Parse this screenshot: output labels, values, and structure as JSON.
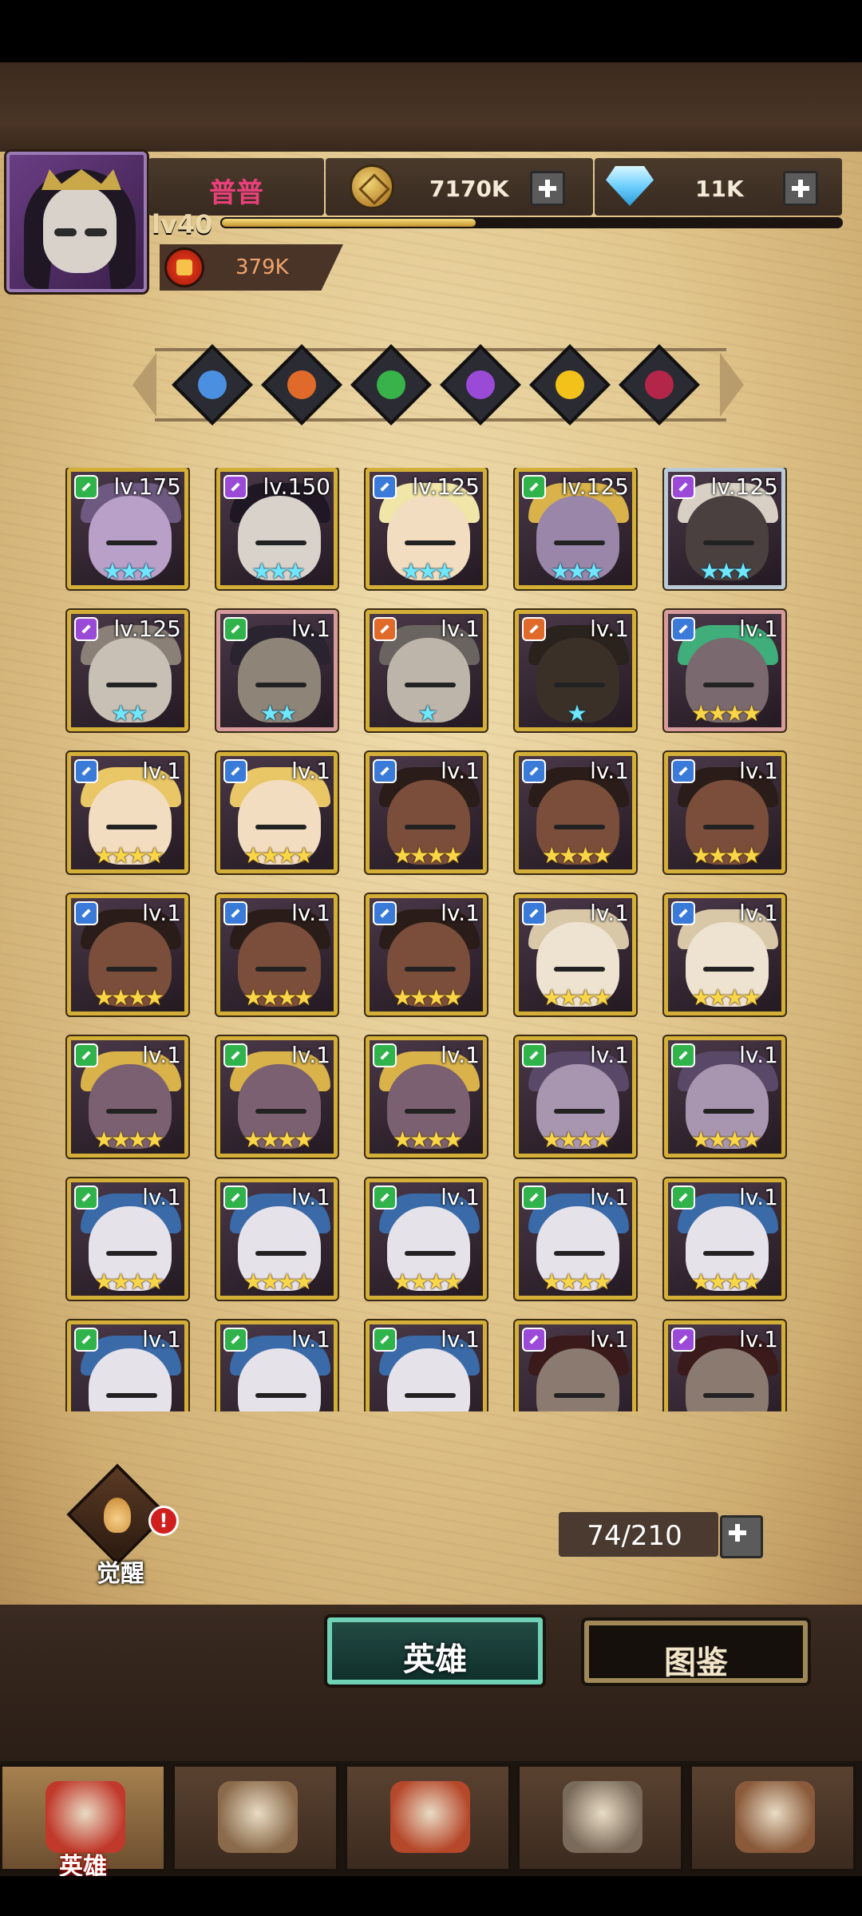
{
  "player": {
    "name": "普普",
    "level": "lv40",
    "xp_fraction": 0.41,
    "power": "379K"
  },
  "resources": {
    "gold": "7170K",
    "gems": "11K"
  },
  "factions": [
    {
      "name": "water-faction-icon",
      "color": "#4a8fe0"
    },
    {
      "name": "fire-faction-icon",
      "color": "#e06a2a"
    },
    {
      "name": "nature-faction-icon",
      "color": "#37b34a"
    },
    {
      "name": "arcane-faction-icon",
      "color": "#9b4ad8"
    },
    {
      "name": "light-faction-icon",
      "color": "#f2c21a"
    },
    {
      "name": "dark-faction-icon",
      "color": "#b4254a"
    }
  ],
  "heroes": [
    {
      "level": "lv.175",
      "stars": 3,
      "star_color": "cyan",
      "frame": "gold",
      "cls_color": "#2fb34a",
      "skin": "#b8a0c8",
      "hair": "#6e5a80"
    },
    {
      "level": "lv.150",
      "stars": 3,
      "star_color": "cyan",
      "frame": "gold",
      "cls_color": "#9b4ad8",
      "skin": "#d8d2cb",
      "hair": "#1f1824"
    },
    {
      "level": "lv.125",
      "stars": 3,
      "star_color": "cyan",
      "frame": "gold",
      "cls_color": "#3a7ad8",
      "skin": "#f2ddc0",
      "hair": "#f0e6a8"
    },
    {
      "level": "lv.125",
      "stars": 3,
      "star_color": "cyan",
      "frame": "gold",
      "cls_color": "#2fb34a",
      "skin": "#9a86a8",
      "hair": "#d9b24a"
    },
    {
      "level": "lv.125",
      "stars": 3,
      "star_color": "cyan",
      "frame": "silver",
      "cls_color": "#9b4ad8",
      "skin": "#4a4040",
      "hair": "#d8d0c4"
    },
    {
      "level": "lv.125",
      "stars": 2,
      "star_color": "cyan",
      "frame": "gold",
      "cls_color": "#9b4ad8",
      "skin": "#c8c0b4",
      "hair": "#8a8078"
    },
    {
      "level": "lv.1",
      "stars": 2,
      "star_color": "cyan",
      "frame": "pink",
      "cls_color": "#2fb34a",
      "skin": "#8e8478",
      "hair": "#2a2430"
    },
    {
      "level": "lv.1",
      "stars": 1,
      "star_color": "cyan",
      "frame": "gold",
      "cls_color": "#e06a2a",
      "skin": "#bdb4aa",
      "hair": "#6a6460"
    },
    {
      "level": "lv.1",
      "stars": 1,
      "star_color": "cyan",
      "frame": "gold",
      "cls_color": "#e06a2a",
      "skin": "#3a3028",
      "hair": "#2a221c"
    },
    {
      "level": "lv.1",
      "stars": 4,
      "star_color": "gold",
      "frame": "pink",
      "cls_color": "#3a7ad8",
      "skin": "#7a6a70",
      "hair": "#3fae7a"
    },
    {
      "level": "lv.1",
      "stars": 4,
      "star_color": "gold",
      "frame": "gold",
      "cls_color": "#3a7ad8",
      "skin": "#f2ddc0",
      "hair": "#e9c766"
    },
    {
      "level": "lv.1",
      "stars": 4,
      "star_color": "gold",
      "frame": "gold",
      "cls_color": "#3a7ad8",
      "skin": "#f2ddc0",
      "hair": "#e9c766"
    },
    {
      "level": "lv.1",
      "stars": 4,
      "star_color": "gold",
      "frame": "gold",
      "cls_color": "#3a7ad8",
      "skin": "#7a4e3a",
      "hair": "#2a1c18"
    },
    {
      "level": "lv.1",
      "stars": 4,
      "star_color": "gold",
      "frame": "gold",
      "cls_color": "#3a7ad8",
      "skin": "#7a4e3a",
      "hair": "#2a1c18"
    },
    {
      "level": "lv.1",
      "stars": 4,
      "star_color": "gold",
      "frame": "gold",
      "cls_color": "#3a7ad8",
      "skin": "#7a4e3a",
      "hair": "#2a1c18"
    },
    {
      "level": "lv.1",
      "stars": 4,
      "star_color": "gold",
      "frame": "gold",
      "cls_color": "#3a7ad8",
      "skin": "#7a4e3a",
      "hair": "#2a1c18"
    },
    {
      "level": "lv.1",
      "stars": 4,
      "star_color": "gold",
      "frame": "gold",
      "cls_color": "#3a7ad8",
      "skin": "#7a4e3a",
      "hair": "#2a1c18"
    },
    {
      "level": "lv.1",
      "stars": 4,
      "star_color": "gold",
      "frame": "gold",
      "cls_color": "#3a7ad8",
      "skin": "#7a4e3a",
      "hair": "#2a1c18"
    },
    {
      "level": "lv.1",
      "stars": 4,
      "star_color": "gold",
      "frame": "gold",
      "cls_color": "#3a7ad8",
      "skin": "#eee2d0",
      "hair": "#d8c8a8"
    },
    {
      "level": "lv.1",
      "stars": 4,
      "star_color": "gold",
      "frame": "gold",
      "cls_color": "#3a7ad8",
      "skin": "#eee2d0",
      "hair": "#d8c8a8"
    },
    {
      "level": "lv.1",
      "stars": 4,
      "star_color": "gold",
      "frame": "gold",
      "cls_color": "#2fb34a",
      "skin": "#7a6070",
      "hair": "#d9b24a"
    },
    {
      "level": "lv.1",
      "stars": 4,
      "star_color": "gold",
      "frame": "gold",
      "cls_color": "#2fb34a",
      "skin": "#7a6070",
      "hair": "#d9b24a"
    },
    {
      "level": "lv.1",
      "stars": 4,
      "star_color": "gold",
      "frame": "gold",
      "cls_color": "#2fb34a",
      "skin": "#7a6070",
      "hair": "#d9b24a"
    },
    {
      "level": "lv.1",
      "stars": 4,
      "star_color": "gold",
      "frame": "gold",
      "cls_color": "#2fb34a",
      "skin": "#a896b0",
      "hair": "#5a4868"
    },
    {
      "level": "lv.1",
      "stars": 4,
      "star_color": "gold",
      "frame": "gold",
      "cls_color": "#2fb34a",
      "skin": "#a896b0",
      "hair": "#5a4868"
    },
    {
      "level": "lv.1",
      "stars": 4,
      "star_color": "gold",
      "frame": "gold",
      "cls_color": "#2fb34a",
      "skin": "#e6e2ea",
      "hair": "#3a6aa8"
    },
    {
      "level": "lv.1",
      "stars": 4,
      "star_color": "gold",
      "frame": "gold",
      "cls_color": "#2fb34a",
      "skin": "#e6e2ea",
      "hair": "#3a6aa8"
    },
    {
      "level": "lv.1",
      "stars": 4,
      "star_color": "gold",
      "frame": "gold",
      "cls_color": "#2fb34a",
      "skin": "#e6e2ea",
      "hair": "#3a6aa8"
    },
    {
      "level": "lv.1",
      "stars": 4,
      "star_color": "gold",
      "frame": "gold",
      "cls_color": "#2fb34a",
      "skin": "#e6e2ea",
      "hair": "#3a6aa8"
    },
    {
      "level": "lv.1",
      "stars": 4,
      "star_color": "gold",
      "frame": "gold",
      "cls_color": "#2fb34a",
      "skin": "#e6e2ea",
      "hair": "#3a6aa8"
    },
    {
      "level": "lv.1",
      "stars": 0,
      "star_color": "gold",
      "frame": "gold",
      "cls_color": "#2fb34a",
      "skin": "#e6e2ea",
      "hair": "#3a6aa8"
    },
    {
      "level": "lv.1",
      "stars": 0,
      "star_color": "gold",
      "frame": "gold",
      "cls_color": "#2fb34a",
      "skin": "#e6e2ea",
      "hair": "#3a6aa8"
    },
    {
      "level": "lv.1",
      "stars": 0,
      "star_color": "gold",
      "frame": "gold",
      "cls_color": "#2fb34a",
      "skin": "#e6e2ea",
      "hair": "#3a6aa8"
    },
    {
      "level": "lv.1",
      "stars": 0,
      "star_color": "gold",
      "frame": "gold",
      "cls_color": "#9b4ad8",
      "skin": "#8a7a70",
      "hair": "#3a1a1a"
    },
    {
      "level": "lv.1",
      "stars": 0,
      "star_color": "gold",
      "frame": "gold",
      "cls_color": "#9b4ad8",
      "skin": "#8a7a70",
      "hair": "#3a1a1a"
    }
  ],
  "awaken": {
    "label": "觉醒",
    "alert": "!"
  },
  "hero_count": "74/210",
  "tabs": {
    "heroes": "英雄",
    "codex": "图鉴"
  },
  "nav": [
    {
      "icon": "knight-helmet-icon",
      "label": "英雄",
      "active": true
    },
    {
      "icon": "wheel-flag-icon",
      "label": "",
      "active": false
    },
    {
      "icon": "crossed-swords-icon",
      "label": "",
      "active": false
    },
    {
      "icon": "castle-tower-icon",
      "label": "",
      "active": false
    },
    {
      "icon": "handshake-crest-icon",
      "label": "",
      "active": false
    }
  ]
}
